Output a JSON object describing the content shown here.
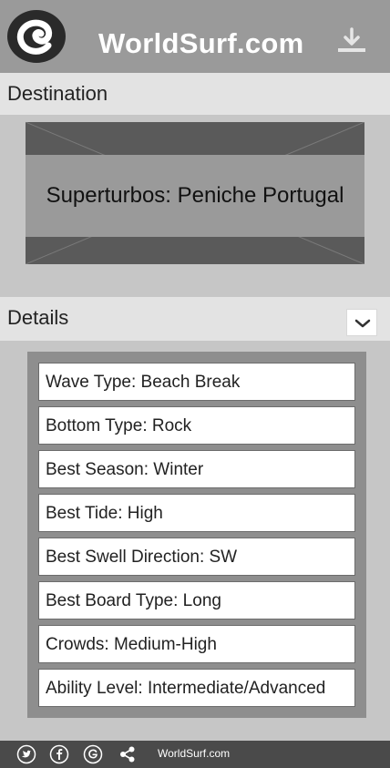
{
  "header": {
    "brand": "WorldSurf.com",
    "logo_icon": "wave-logo-icon",
    "download_icon": "download-icon"
  },
  "destination": {
    "section_label": "Destination",
    "spot_name": "Superturbos: Peniche Portugal"
  },
  "details": {
    "section_label": "Details",
    "toggle_icon": "chevron-down-icon",
    "items": [
      "Wave Type: Beach Break",
      "Bottom Type: Rock",
      "Best Season: Winter",
      "Best Tide: High",
      "Best Swell Direction: SW",
      "Best Board Type: Long",
      "Crowds: Medium-High",
      "Ability Level: Intermediate/Advanced"
    ]
  },
  "footer": {
    "icons": [
      "twitter-icon",
      "facebook-icon",
      "google-icon",
      "share-icon"
    ],
    "text": "WorldSurf.com"
  },
  "colors": {
    "header_bg": "#9a9a9a",
    "section_bar_bg": "#e3e3e3",
    "page_bg": "#c6c6c6",
    "footer_bg": "#4a4a4a"
  }
}
